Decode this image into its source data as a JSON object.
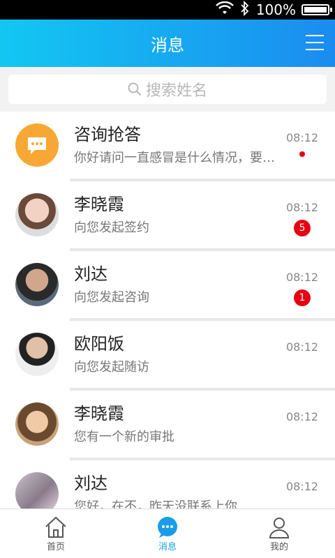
{
  "status": {
    "battery": "100%"
  },
  "header": {
    "title": "消息"
  },
  "search": {
    "placeholder": "搜索姓名"
  },
  "messages": [
    {
      "name": "咨询抢答",
      "text": "你好请问一直感冒是什么情况，要…",
      "time": "08:12",
      "badge": "",
      "dot": true,
      "avatar": "chat-icon"
    },
    {
      "name": "李晓霞",
      "text": "向您发起签约",
      "time": "08:12",
      "badge": "5",
      "dot": false,
      "avatar": "photo"
    },
    {
      "name": "刘达",
      "text": "向您发起咨询",
      "time": "08:12",
      "badge": "1",
      "dot": false,
      "avatar": "photo"
    },
    {
      "name": "欧阳饭",
      "text": "向您发起随访",
      "time": "08:12",
      "badge": "",
      "dot": false,
      "avatar": "photo"
    },
    {
      "name": "李晓霞",
      "text": "您有一个新的审批",
      "time": "08:12",
      "badge": "",
      "dot": false,
      "avatar": "photo"
    },
    {
      "name": "刘达",
      "text": "您好，在不，昨天没联系上你",
      "time": "08:12",
      "badge": "",
      "dot": false,
      "avatar": "photo"
    }
  ],
  "tabs": [
    {
      "label": "首页",
      "icon": "home-icon"
    },
    {
      "label": "消息",
      "icon": "message-icon"
    },
    {
      "label": "我的",
      "icon": "user-icon"
    }
  ],
  "colors": {
    "accent": "#1a9de8",
    "badge": "#e60012",
    "chat_avatar": "#f7a834"
  }
}
